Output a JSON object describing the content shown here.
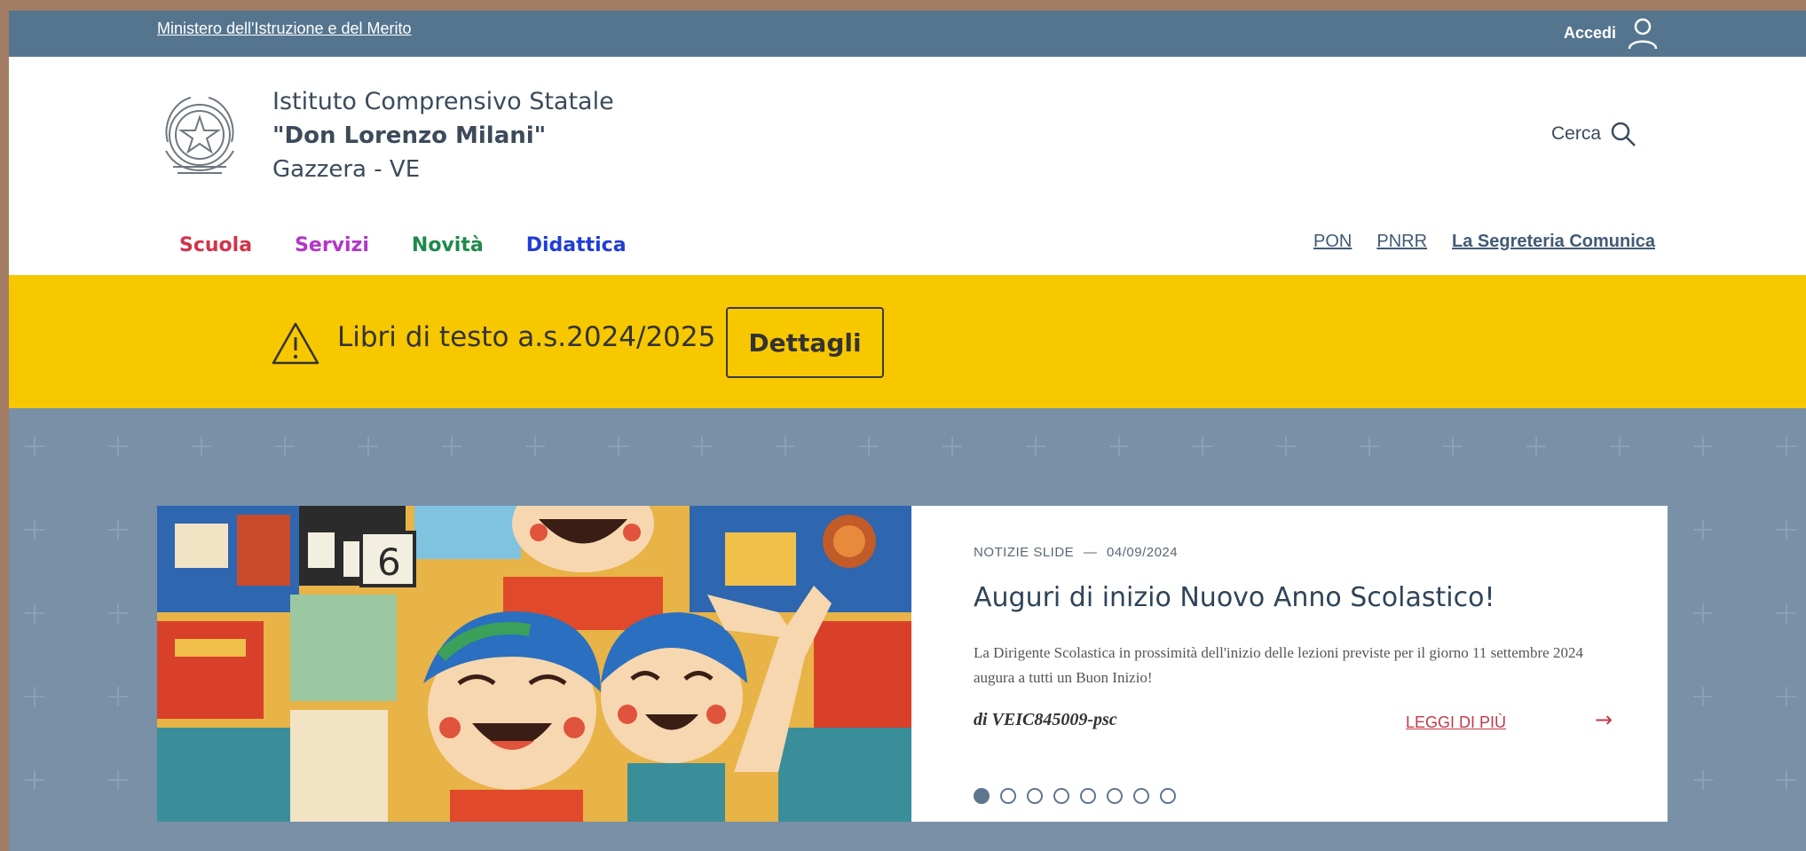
{
  "topbar": {
    "ministry_link": "Ministero dell'Istruzione e del Merito",
    "login_label": "Accedi"
  },
  "header": {
    "school_line1": "Istituto Comprensivo Statale",
    "school_line2": "\"Don Lorenzo Milani\"",
    "school_line3": "Gazzera - VE",
    "search_label": "Cerca"
  },
  "main_nav": [
    {
      "label": "Scuola",
      "color": "#d1344a"
    },
    {
      "label": "Servizi",
      "color": "#b236c9"
    },
    {
      "label": "Novità",
      "color": "#1e8a4a"
    },
    {
      "label": "Didattica",
      "color": "#1f3dd6"
    }
  ],
  "utility_nav": {
    "pon": "PON",
    "pnrr": "PNRR",
    "segreteria": "La Segreteria Comunica"
  },
  "alert": {
    "text": "Libri di testo a.s.2024/2025",
    "button": "Dettagli"
  },
  "slide": {
    "category": "NOTIZIE SLIDE",
    "separator": "—",
    "date": "04/09/2024",
    "title": "Auguri di inizio Nuovo Anno Scolastico!",
    "description": "La Dirigente Scolastica in prossimità dell'inizio delle lezioni previste per il giorno 11 settembre 2024 augura a tutti un Buon Inizio!",
    "author": "di VEIC845009-psc",
    "read_more": "LEGGI DI PIÙ",
    "arrow_icon": "arrow-right-icon",
    "dots_total": 8,
    "dot_active": 1
  },
  "colors": {
    "topbar": "#55758f",
    "alert": "#f7c800",
    "hero": "#6a849c",
    "accent_red": "#c23a4a"
  }
}
